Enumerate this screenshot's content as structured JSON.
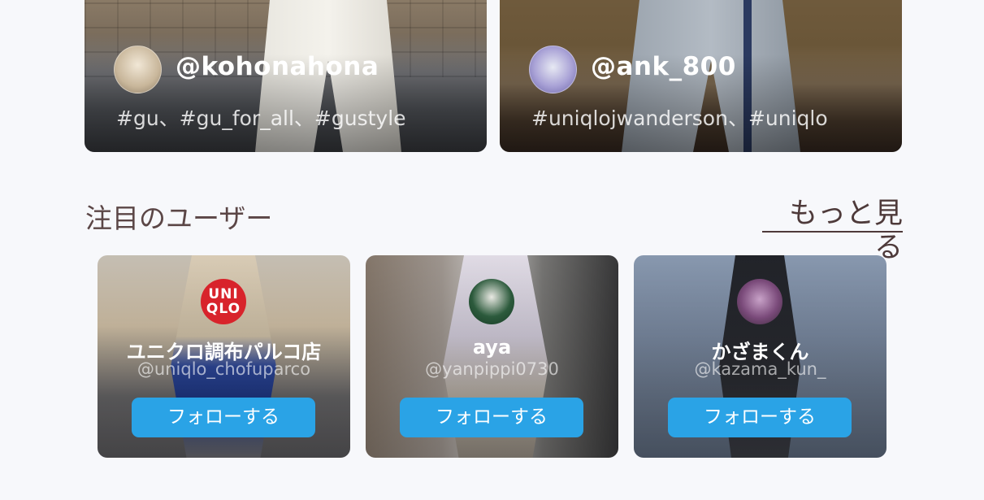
{
  "posts": [
    {
      "handle": "@kohonahona",
      "tags": "#gu、#gu_for_all、#gustyle"
    },
    {
      "handle": "@ank_800",
      "tags": "#uniqlojwanderson、#uniqlo"
    }
  ],
  "featured": {
    "title": "注目のユーザー",
    "more_label": "もっと見る"
  },
  "users": [
    {
      "name": "ユニクロ調布パルコ店",
      "handle": "@uniqlo_chofuparco",
      "logo": [
        "UNI",
        "QLO"
      ],
      "follow_label": "フォローする"
    },
    {
      "name": "aya",
      "handle": "@yanpippi0730",
      "follow_label": "フォローする"
    },
    {
      "name": "かざまくん",
      "handle": "@kazama_kun_",
      "follow_label": "フォローする"
    }
  ],
  "colors": {
    "follow_button": "#2aa3e6",
    "section_text": "#5b4646",
    "logo_red": "#d8232b"
  }
}
